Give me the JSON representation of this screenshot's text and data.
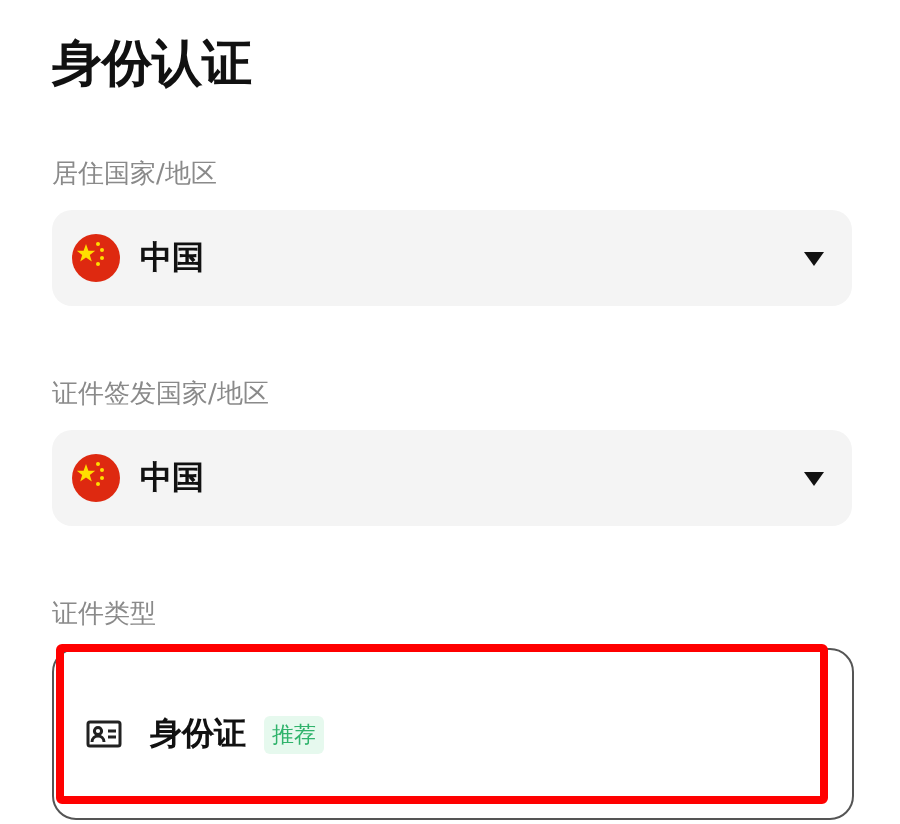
{
  "title": "身份认证",
  "fields": [
    {
      "label": "居住国家/地区",
      "value": "中国"
    },
    {
      "label": "证件签发国家/地区",
      "value": "中国"
    }
  ],
  "document_type": {
    "label": "证件类型",
    "options": [
      {
        "name": "身份证",
        "badge": "推荐",
        "highlighted": true
      }
    ]
  }
}
